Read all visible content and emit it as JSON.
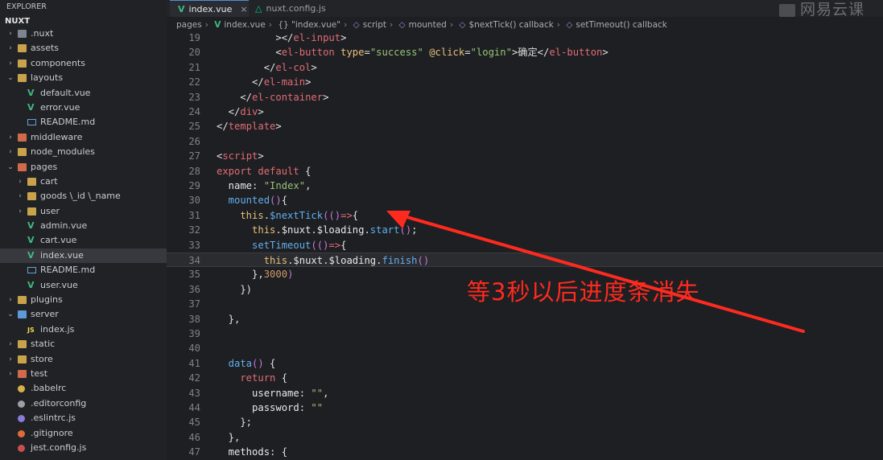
{
  "sidebar": {
    "header": "EXPLORER",
    "root": "NUXT",
    "items": [
      {
        "label": ".nuxt",
        "depth": 0,
        "kind": "folder-gray",
        "chev": ">"
      },
      {
        "label": "assets",
        "depth": 0,
        "kind": "folder",
        "chev": ">"
      },
      {
        "label": "components",
        "depth": 0,
        "kind": "folder",
        "chev": ">"
      },
      {
        "label": "layouts",
        "depth": 0,
        "kind": "folder",
        "chev": "v"
      },
      {
        "label": "default.vue",
        "depth": 1,
        "kind": "vue"
      },
      {
        "label": "error.vue",
        "depth": 1,
        "kind": "vue"
      },
      {
        "label": "README.md",
        "depth": 1,
        "kind": "md"
      },
      {
        "label": "middleware",
        "depth": 0,
        "kind": "folder-red",
        "chev": ">"
      },
      {
        "label": "node_modules",
        "depth": 0,
        "kind": "folder",
        "chev": ">"
      },
      {
        "label": "pages",
        "depth": 0,
        "kind": "folder-red",
        "chev": "v"
      },
      {
        "label": "cart",
        "depth": 1,
        "kind": "folder",
        "chev": ">"
      },
      {
        "label": "goods \\_id \\_name",
        "depth": 1,
        "kind": "folder",
        "chev": ">"
      },
      {
        "label": "user",
        "depth": 1,
        "kind": "folder",
        "chev": ">"
      },
      {
        "label": "admin.vue",
        "depth": 1,
        "kind": "vue"
      },
      {
        "label": "cart.vue",
        "depth": 1,
        "kind": "vue"
      },
      {
        "label": "index.vue",
        "depth": 1,
        "kind": "vue",
        "selected": true
      },
      {
        "label": "README.md",
        "depth": 1,
        "kind": "md"
      },
      {
        "label": "user.vue",
        "depth": 1,
        "kind": "vue"
      },
      {
        "label": "plugins",
        "depth": 0,
        "kind": "folder",
        "chev": ">"
      },
      {
        "label": "server",
        "depth": 0,
        "kind": "folder-blue",
        "chev": "v"
      },
      {
        "label": "index.js",
        "depth": 1,
        "kind": "js"
      },
      {
        "label": "static",
        "depth": 0,
        "kind": "folder",
        "chev": ">"
      },
      {
        "label": "store",
        "depth": 0,
        "kind": "folder",
        "chev": ">"
      },
      {
        "label": "test",
        "depth": 0,
        "kind": "folder-red",
        "chev": ">"
      },
      {
        "label": ".babelrc",
        "depth": 0,
        "kind": "file-yellow"
      },
      {
        "label": ".editorconfig",
        "depth": 0,
        "kind": "file-gray"
      },
      {
        "label": ".eslintrc.js",
        "depth": 0,
        "kind": "file-purple"
      },
      {
        "label": ".gitignore",
        "depth": 0,
        "kind": "file-orange"
      },
      {
        "label": "jest.config.js",
        "depth": 0,
        "kind": "file-red"
      }
    ]
  },
  "tabs": [
    {
      "label": "index.vue",
      "active": true,
      "close": "×"
    },
    {
      "label": "nuxt.config.js",
      "active": false
    }
  ],
  "watermark": "网易云课",
  "breadcrumb": [
    "pages",
    "index.vue",
    "{} \"index.vue\"",
    "script",
    "mounted",
    "$nextTick() callback",
    "setTimeout() callback"
  ],
  "code": [
    {
      "n": "19",
      "tokens": [
        [
          "pun",
          "          ></"
        ],
        [
          "tag",
          "el-input"
        ],
        [
          "pun",
          ">"
        ]
      ]
    },
    {
      "n": "20",
      "tokens": [
        [
          "pun",
          "          <"
        ],
        [
          "tag",
          "el-button"
        ],
        [
          "pun",
          " "
        ],
        [
          "attr",
          "type"
        ],
        [
          "pun",
          "="
        ],
        [
          "str",
          "\"success\""
        ],
        [
          "pun",
          " "
        ],
        [
          "attr",
          "@click"
        ],
        [
          "pun",
          "="
        ],
        [
          "str",
          "\"login\""
        ],
        [
          "pun",
          ">"
        ],
        [
          "text",
          "确定"
        ],
        [
          "pun",
          "</"
        ],
        [
          "tag",
          "el-button"
        ],
        [
          "pun",
          ">"
        ]
      ]
    },
    {
      "n": "21",
      "tokens": [
        [
          "pun",
          "        </"
        ],
        [
          "tag",
          "el-col"
        ],
        [
          "pun",
          ">"
        ]
      ]
    },
    {
      "n": "22",
      "tokens": [
        [
          "pun",
          "      </"
        ],
        [
          "tag",
          "el-main"
        ],
        [
          "pun",
          ">"
        ]
      ]
    },
    {
      "n": "23",
      "tokens": [
        [
          "pun",
          "    </"
        ],
        [
          "tag",
          "el-container"
        ],
        [
          "pun",
          ">"
        ]
      ]
    },
    {
      "n": "24",
      "tokens": [
        [
          "pun",
          "  </"
        ],
        [
          "tag",
          "div"
        ],
        [
          "pun",
          ">"
        ]
      ]
    },
    {
      "n": "25",
      "tokens": [
        [
          "pun",
          "</"
        ],
        [
          "tag",
          "template"
        ],
        [
          "pun",
          ">"
        ]
      ]
    },
    {
      "n": "26",
      "tokens": []
    },
    {
      "n": "27",
      "tokens": [
        [
          "pun",
          "<"
        ],
        [
          "tag",
          "script"
        ],
        [
          "pun",
          ">"
        ]
      ]
    },
    {
      "n": "28",
      "tokens": [
        [
          "kw",
          "export default"
        ],
        [
          "pun",
          " {"
        ]
      ]
    },
    {
      "n": "29",
      "tokens": [
        [
          "key",
          "  name"
        ],
        [
          "pun",
          ": "
        ],
        [
          "str",
          "\"Index\""
        ],
        [
          "pun",
          ","
        ]
      ]
    },
    {
      "n": "30",
      "tokens": [
        [
          "fn",
          "  mounted"
        ],
        [
          "paren",
          "()"
        ],
        [
          "pun",
          "{"
        ]
      ]
    },
    {
      "n": "31",
      "tokens": [
        [
          "this",
          "    this"
        ],
        [
          "pun",
          "."
        ],
        [
          "fn",
          "$nextTick"
        ],
        [
          "paren",
          "(()"
        ],
        [
          "kw",
          "=>"
        ],
        [
          "pun",
          "{"
        ]
      ]
    },
    {
      "n": "32",
      "tokens": [
        [
          "this",
          "      this"
        ],
        [
          "pun",
          "."
        ],
        [
          "var",
          "$nuxt"
        ],
        [
          "pun",
          "."
        ],
        [
          "var",
          "$loading"
        ],
        [
          "pun",
          "."
        ],
        [
          "fn",
          "start"
        ],
        [
          "paren",
          "()"
        ],
        [
          "pun",
          ";"
        ]
      ]
    },
    {
      "n": "33",
      "tokens": [
        [
          "fn",
          "      setTimeout"
        ],
        [
          "paren",
          "(()"
        ],
        [
          "kw",
          "=>"
        ],
        [
          "pun",
          "{"
        ]
      ]
    },
    {
      "n": "34",
      "tokens": [
        [
          "this",
          "        this"
        ],
        [
          "pun",
          "."
        ],
        [
          "var",
          "$nuxt"
        ],
        [
          "pun",
          "."
        ],
        [
          "var",
          "$loading"
        ],
        [
          "pun",
          "."
        ],
        [
          "fn",
          "finish"
        ],
        [
          "paren",
          "()"
        ]
      ],
      "hl": true
    },
    {
      "n": "35",
      "tokens": [
        [
          "pun",
          "      },"
        ],
        [
          "num",
          "3000"
        ],
        [
          "paren",
          ")"
        ]
      ]
    },
    {
      "n": "36",
      "tokens": [
        [
          "pun",
          "    })"
        ]
      ]
    },
    {
      "n": "37",
      "tokens": []
    },
    {
      "n": "38",
      "tokens": [
        [
          "pun",
          "  },"
        ]
      ]
    },
    {
      "n": "39",
      "tokens": []
    },
    {
      "n": "40",
      "tokens": []
    },
    {
      "n": "41",
      "tokens": [
        [
          "fn",
          "  data"
        ],
        [
          "paren",
          "()"
        ],
        [
          "pun",
          " {"
        ]
      ]
    },
    {
      "n": "42",
      "tokens": [
        [
          "kw",
          "    return"
        ],
        [
          "pun",
          " {"
        ]
      ]
    },
    {
      "n": "43",
      "tokens": [
        [
          "key",
          "      username"
        ],
        [
          "pun",
          ": "
        ],
        [
          "str",
          "\"\""
        ],
        [
          "pun",
          ","
        ]
      ]
    },
    {
      "n": "44",
      "tokens": [
        [
          "key",
          "      password"
        ],
        [
          "pun",
          ": "
        ],
        [
          "str",
          "\"\""
        ]
      ]
    },
    {
      "n": "45",
      "tokens": [
        [
          "pun",
          "    };"
        ]
      ]
    },
    {
      "n": "46",
      "tokens": [
        [
          "pun",
          "  },"
        ]
      ]
    },
    {
      "n": "47",
      "tokens": [
        [
          "key",
          "  methods"
        ],
        [
          "pun",
          ": {"
        ]
      ]
    }
  ],
  "annotation": "等3秒以后进度条消失",
  "colors": {
    "arrow": "#ff2a1f"
  }
}
